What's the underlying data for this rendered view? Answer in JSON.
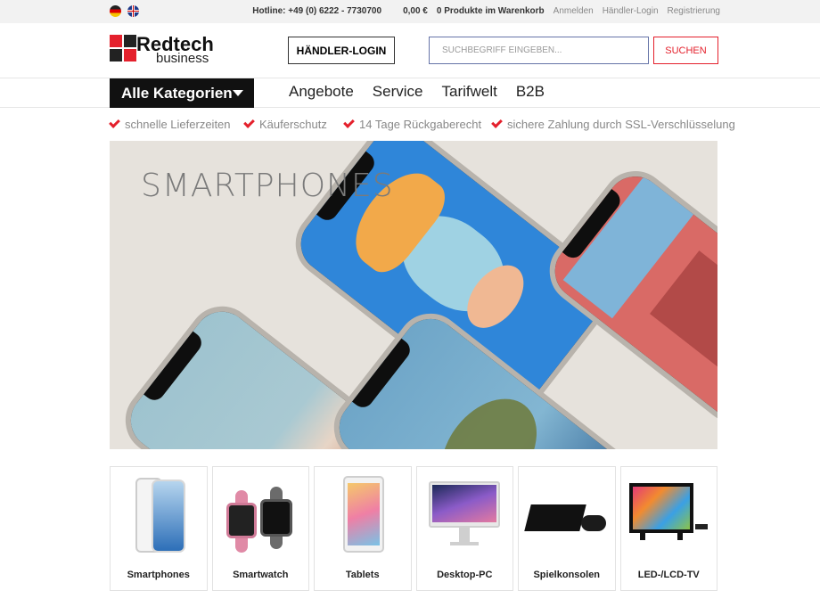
{
  "topbar": {
    "hotline": "Hotline: +49 (0) 6222 - 7730700",
    "cart_total": "0,00 €",
    "cart_items": "0 Produkte im Warenkorb",
    "login": "Anmelden",
    "dealer_login": "Händler-Login",
    "register": "Registrierung"
  },
  "header": {
    "logo_line1": "Redtech",
    "logo_line2": "business",
    "dealer_button": "HÄNDLER-LOGIN",
    "search_placeholder": "SUCHBEGRIFF EINGEBEN...",
    "search_button": "SUCHEN"
  },
  "nav": {
    "all_categories": "Alle Kategorien",
    "items": [
      "Angebote",
      "Service",
      "Tarifwelt",
      "B2B"
    ]
  },
  "usps": [
    "schnelle Lieferzeiten",
    "Käuferschutz",
    "14 Tage Rückgaberecht",
    "sichere Zahlung durch SSL-Verschlüsselung"
  ],
  "banner": {
    "title": "SMARTPHONES"
  },
  "categories": [
    "Smartphones",
    "Smartwatch",
    "Tablets",
    "Desktop-PC",
    "Spielkonsolen",
    "LED-/LCD-TV"
  ],
  "colors": {
    "accent": "#e4202c",
    "dark": "#111111"
  }
}
